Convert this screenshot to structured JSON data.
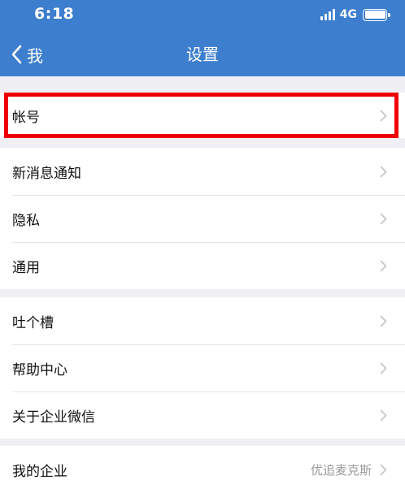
{
  "status_bar": {
    "time": "6:18",
    "network": "4G",
    "icons": [
      "signal-icon",
      "battery-icon"
    ]
  },
  "nav": {
    "back_label": "我",
    "title": "设置"
  },
  "sections": [
    {
      "items": [
        {
          "label": "帐号"
        }
      ]
    },
    {
      "items": [
        {
          "label": "新消息通知"
        },
        {
          "label": "隐私"
        },
        {
          "label": "通用"
        }
      ]
    },
    {
      "items": [
        {
          "label": "吐个槽"
        },
        {
          "label": "帮助中心"
        },
        {
          "label": "关于企业微信"
        }
      ]
    },
    {
      "items": [
        {
          "label": "我的企业",
          "value": "优追麦克斯"
        }
      ]
    }
  ],
  "colors": {
    "header_bg": "#3d7ece",
    "page_bg": "#efeff4",
    "highlight": "#ee0000"
  }
}
